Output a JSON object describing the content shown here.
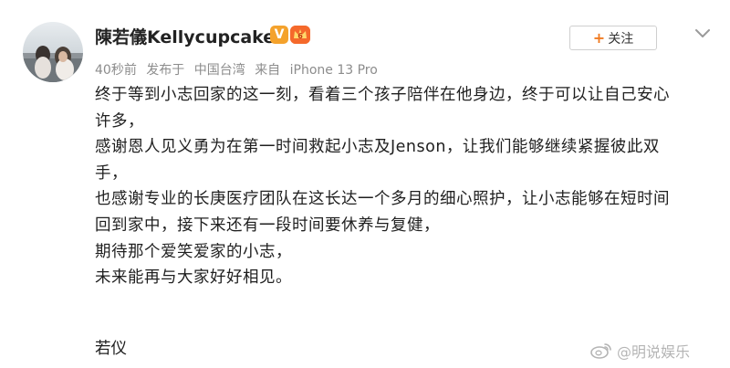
{
  "post": {
    "author": {
      "name": "陳若儀Kellycupcake",
      "vip_badge": "V",
      "level_badge": "6"
    },
    "meta": {
      "time": "40秒前",
      "location_label": "发布于",
      "location": "中国台湾",
      "source_label": "来自",
      "device": "iPhone 13 Pro"
    },
    "follow_label": "关注",
    "content_lines": [
      "终于等到小志回家的这一刻，看着三个孩子陪伴在他身边，终于可以让自己安心",
      "许多，",
      "感谢恩人见义勇为在第一时间救起小志及Jenson，让我们能够继续紧握彼此双",
      "手，",
      "也感谢专业的长庚医疗团队在这长达一个多月的细心照护，让小志能够在短时间",
      "回到家中，接下来还有一段时间要休养与复健，",
      "期待那个爱笑爱家的小志，",
      "未来能再与大家好好相见。"
    ],
    "signature": "若仪"
  },
  "watermark": {
    "text": "@明说娱乐"
  },
  "colors": {
    "accent_orange": "#f07b22",
    "vip_badge": "#f4a22c",
    "meta_gray": "#8c8c8c"
  }
}
